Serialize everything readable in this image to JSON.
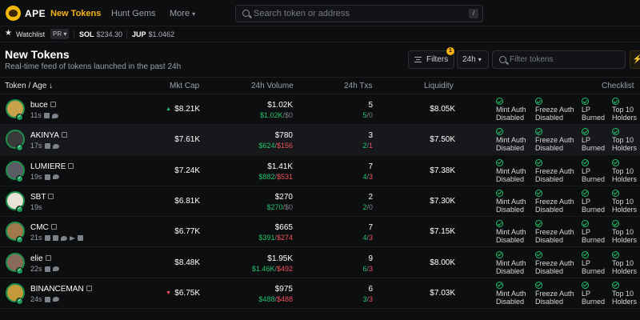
{
  "nav": {
    "logo_text": "APE",
    "items": [
      {
        "label": "New Tokens"
      },
      {
        "label": "Hunt Gems"
      },
      {
        "label": "More"
      }
    ],
    "search_placeholder": "Search token or address",
    "search_shortcut": "/"
  },
  "subbar": {
    "watchlist_label": "Watchlist",
    "watchlist_pill": "PR",
    "tickers": [
      {
        "symbol": "SOL",
        "price": "$234.30"
      },
      {
        "symbol": "JUP",
        "price": "$1.0462"
      }
    ]
  },
  "page": {
    "title": "New Tokens",
    "subtitle": "Real-time feed of tokens launched in the past 24h",
    "filters_label": "Filters",
    "filters_count": "1",
    "period_label": "24h",
    "filter_placeholder": "Filter tokens"
  },
  "columns": {
    "token": "Token / Age",
    "mcap": "Mkt Cap",
    "volume": "24h Volume",
    "txs": "24h Txs",
    "liquidity": "Liquidity",
    "checklist": "Checklist"
  },
  "checklist_labels": {
    "mint": [
      "Mint Auth",
      "Disabled"
    ],
    "freeze": [
      "Freeze Auth",
      "Disabled"
    ],
    "lp": [
      "LP",
      "Burned"
    ],
    "top10": [
      "Top 10",
      "Holders"
    ]
  },
  "colors": {
    "accent": "#f5b316",
    "buy": "#22c36b",
    "sell": "#f0515a"
  },
  "tokens": [
    {
      "name": "buce",
      "age": "11s",
      "trend": "up",
      "mcap": "$8.21K",
      "volume": "$1.02K",
      "vol_buy": "$1.02K",
      "vol_sell": "$0",
      "txs": "5",
      "tx_buy": "5",
      "tx_sell": "0",
      "liquidity": "$8.05K",
      "avatar_color": "#c9a24a"
    },
    {
      "name": "AKINYA",
      "age": "17s",
      "trend": "",
      "mcap": "$7.61K",
      "volume": "$780",
      "vol_buy": "$624",
      "vol_sell": "$156",
      "txs": "3",
      "tx_buy": "2",
      "tx_sell": "1",
      "liquidity": "$7.50K",
      "avatar_color": "#3a3a3a"
    },
    {
      "name": "LUMIERE",
      "age": "19s",
      "trend": "",
      "mcap": "$7.24K",
      "volume": "$1.41K",
      "vol_buy": "$882",
      "vol_sell": "$531",
      "txs": "7",
      "tx_buy": "4",
      "tx_sell": "3",
      "liquidity": "$7.38K",
      "avatar_color": "#5a5d63"
    },
    {
      "name": "SBT",
      "age": "19s",
      "trend": "",
      "mcap": "$6.81K",
      "volume": "$270",
      "vol_buy": "$270",
      "vol_sell": "$0",
      "txs": "2",
      "tx_buy": "2",
      "tx_sell": "0",
      "liquidity": "$7.30K",
      "avatar_color": "#e9e2d6"
    },
    {
      "name": "CMC",
      "age": "21s",
      "trend": "",
      "mcap": "$6.77K",
      "volume": "$665",
      "vol_buy": "$391",
      "vol_sell": "$274",
      "txs": "7",
      "tx_buy": "4",
      "tx_sell": "3",
      "liquidity": "$7.15K",
      "avatar_color": "#a0794a"
    },
    {
      "name": "elie",
      "age": "22s",
      "trend": "",
      "mcap": "$8.48K",
      "volume": "$1.95K",
      "vol_buy": "$1.46K",
      "vol_sell": "$492",
      "txs": "9",
      "tx_buy": "6",
      "tx_sell": "3",
      "liquidity": "$8.00K",
      "avatar_color": "#8a6b5a"
    },
    {
      "name": "BINANCEMAN",
      "age": "24s",
      "trend": "down",
      "mcap": "$6.75K",
      "volume": "$975",
      "vol_buy": "$488",
      "vol_sell": "$488",
      "txs": "6",
      "tx_buy": "3",
      "tx_sell": "3",
      "liquidity": "$7.03K",
      "avatar_color": "#c49a3a"
    }
  ]
}
